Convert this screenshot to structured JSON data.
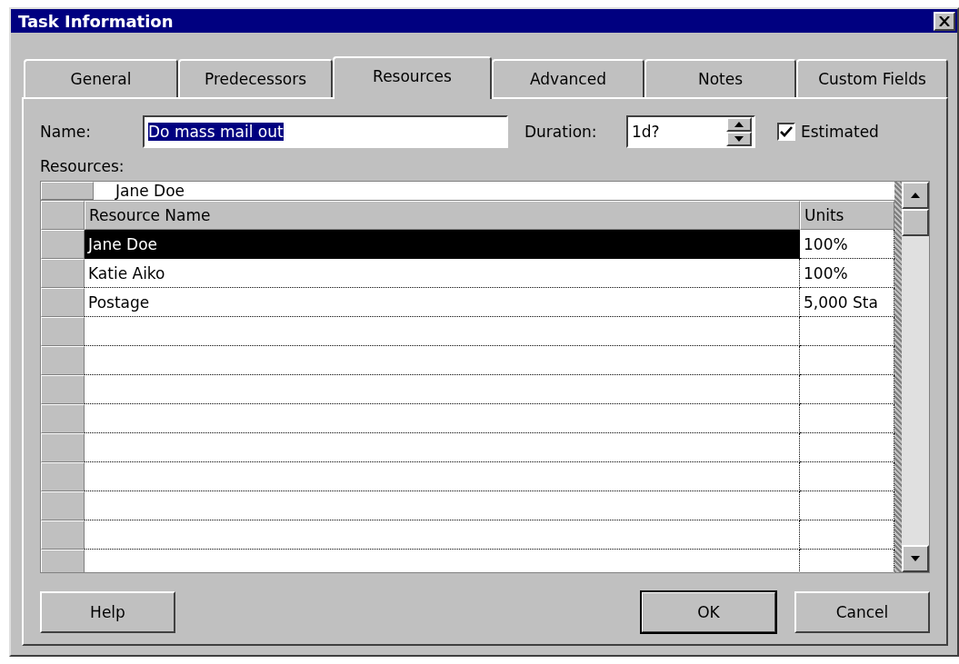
{
  "window": {
    "title": "Task Information"
  },
  "tabs": [
    {
      "label": "General",
      "selected": false
    },
    {
      "label": "Predecessors",
      "selected": false
    },
    {
      "label": "Resources",
      "selected": true
    },
    {
      "label": "Advanced",
      "selected": false
    },
    {
      "label": "Notes",
      "selected": false
    },
    {
      "label": "Custom Fields",
      "selected": false
    }
  ],
  "name_field": {
    "label": "Name:",
    "value": "Do mass mail out"
  },
  "duration_field": {
    "label": "Duration:",
    "value": "1d?"
  },
  "estimated": {
    "label": "Estimated",
    "checked": true
  },
  "resources": {
    "label": "Resources:",
    "edit_value": "Jane Doe",
    "columns": [
      "Resource Name",
      "Units"
    ],
    "rows": [
      {
        "name": "Jane Doe",
        "units": "100%",
        "selected": true
      },
      {
        "name": "Katie Aiko",
        "units": "100%",
        "selected": false
      },
      {
        "name": "Postage",
        "units": "5,000 Sta",
        "selected": false
      }
    ]
  },
  "buttons": [
    {
      "label": "Help",
      "default": false
    },
    {
      "label": "OK",
      "default": true
    },
    {
      "label": "Cancel",
      "default": false
    }
  ]
}
